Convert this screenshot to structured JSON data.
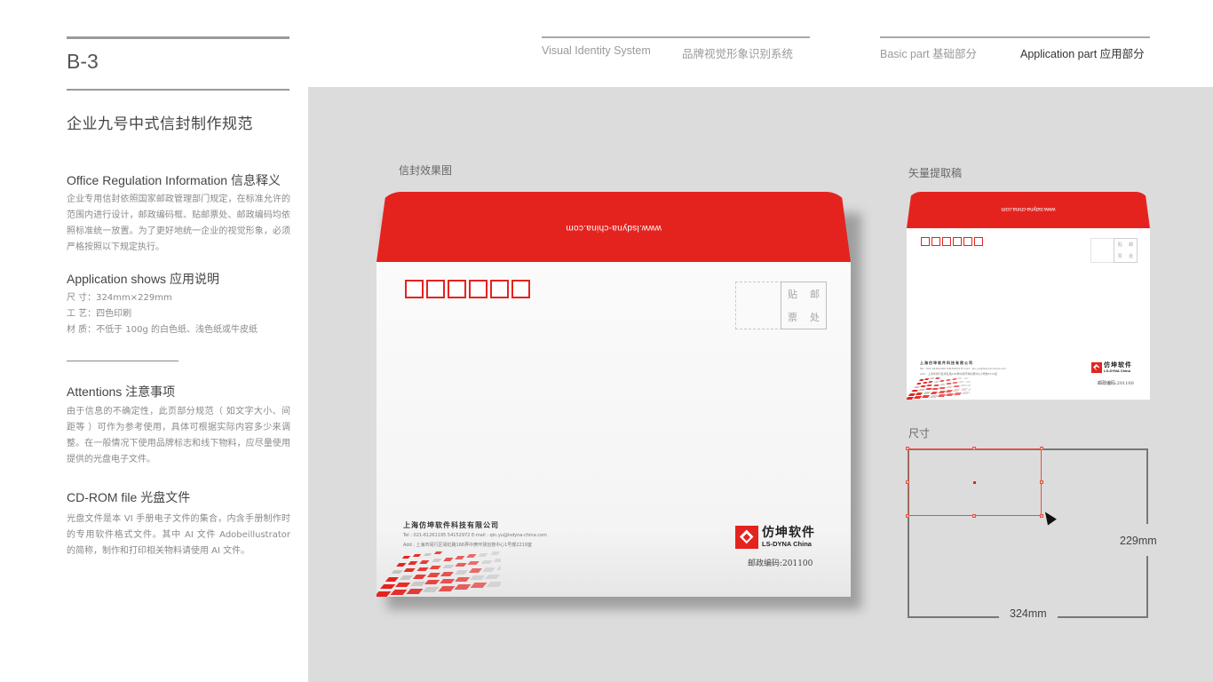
{
  "page": {
    "code": "B-3",
    "title": "企业九号中式信封制作规范"
  },
  "header": {
    "system_en": "Visual Identity System",
    "system_cn": "品牌视觉形象识别系统",
    "nav": [
      {
        "label": "Basic part  基础部分",
        "active": false
      },
      {
        "label": "Application part  应用部分",
        "active": true
      }
    ]
  },
  "sections": {
    "office": {
      "title_en": "Office Regulation Information ",
      "title_cn": "信息释义",
      "body": "企业专用信封依照国家邮政管理部门规定，在标准允许的范围内进行设计，邮政编码框、贴邮票处、邮政编码均依照标准统一放置。为了更好地统一企业的视觉形象，必须严格按照以下规定执行。"
    },
    "application": {
      "title_en": "Application shows ",
      "title_cn": "应用说明",
      "lines": [
        "尺 寸：324mm×229mm",
        "工 艺：四色印刷",
        "材 质：不低于 100g 的白色纸、浅色纸或牛皮纸"
      ]
    },
    "attentions": {
      "title_en": "Attentions ",
      "title_cn": "注意事项",
      "body": "由于信息的不确定性，此页部分规范（ 如文字大小、间距等 ）可作为参考使用，具体可根据实际内容多少来调整。在一般情况下使用品牌标志和线下物料，应尽量使用提供的光盘电子文件。"
    },
    "cdrom": {
      "title_en": "CD-ROM file ",
      "title_cn": "光盘文件",
      "body": "光盘文件是本 VI 手册电子文件的集合，内含手册制作时的专用软件格式文件。其中 AI 文件 Adobeillustrator 的简称，制作和打印相关物料请使用 AI 文件。"
    }
  },
  "panel": {
    "effect_label": "信封效果图",
    "vector_label": "矢量提取稿",
    "size_label": "尺寸"
  },
  "envelope": {
    "flap_url": "www.lsdyna-china.com",
    "zip_box_count": 6,
    "stamp_chars": [
      "贴",
      "邮",
      "票",
      "处"
    ],
    "company": "上海仿坤软件科技有限公司",
    "tel": "Tel : 021-61261195    54152972    E-mail : qin.yu@lsdyna-china.com",
    "address": "Add : 上海市闵行区闵虹路166弄中庚环球创意中心1号楼2219室",
    "logo_cn": "仿坤软件",
    "logo_en": "LS-DYNA China",
    "postcode": "邮政编码:201100",
    "brand_color": "#e4231f"
  },
  "dimensions": {
    "width": "324mm",
    "height": "229mm"
  }
}
